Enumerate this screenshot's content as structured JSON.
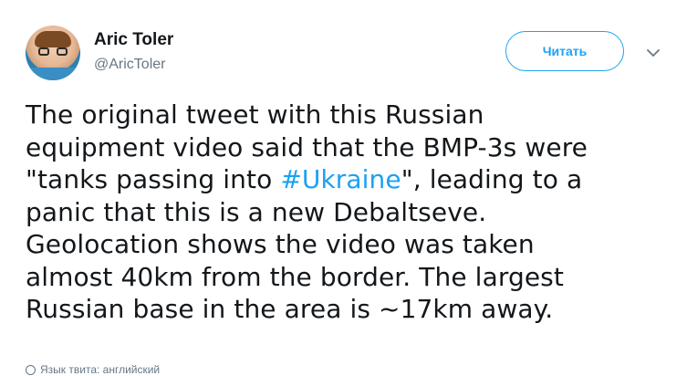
{
  "author": {
    "name": "Aric Toler",
    "handle": "@AricToler"
  },
  "follow_button": {
    "label": "Читать"
  },
  "tweet": {
    "lines": {
      "l1": "The original tweet with this Russian",
      "l2": "equipment video said that the BMP-3s were",
      "l3_before": "\"tanks passing into ",
      "l3_hashtag": "#Ukraine",
      "l3_after": "\", leading to a",
      "l4": "panic that this is a new Debaltseve.",
      "l5": "Geolocation shows the video was taken",
      "l6": "almost 40km from the border. The largest",
      "l7": "Russian base in the area is ~17km away."
    }
  },
  "translate": {
    "label": "Язык твита: английский"
  },
  "colors": {
    "accent": "#1da1f2",
    "text": "#14171a",
    "muted": "#657786"
  },
  "icons": {
    "caret": "chevron-down-icon",
    "globe": "globe-icon"
  }
}
